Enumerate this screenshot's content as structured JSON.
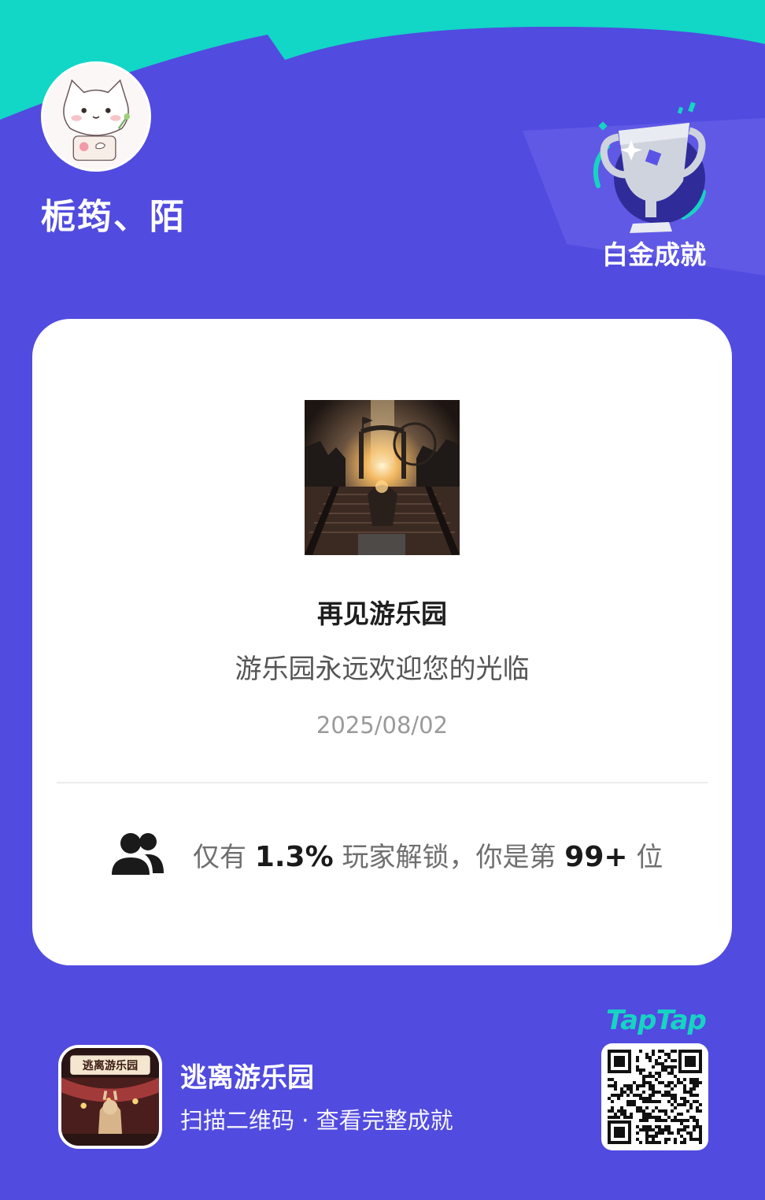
{
  "user": {
    "name": "栀筠、陌"
  },
  "badge": {
    "label": "白金成就"
  },
  "achievement": {
    "title": "再见游乐园",
    "description": "游乐园永远欢迎您的光临",
    "date": "2025/08/02"
  },
  "stats": {
    "prefix": "仅有",
    "percent": "1.3%",
    "middle": "玩家解锁，你是第",
    "rank": "99+",
    "suffix": "位"
  },
  "game": {
    "name": "逃离游乐园",
    "subtitle": "扫描二维码 · 查看完整成就",
    "icon_banner": "逃离游乐园"
  },
  "brand": {
    "logo_text": "TapTap"
  },
  "colors": {
    "background": "#514be0",
    "accent_teal": "#17d3c2",
    "card": "#ffffff"
  }
}
